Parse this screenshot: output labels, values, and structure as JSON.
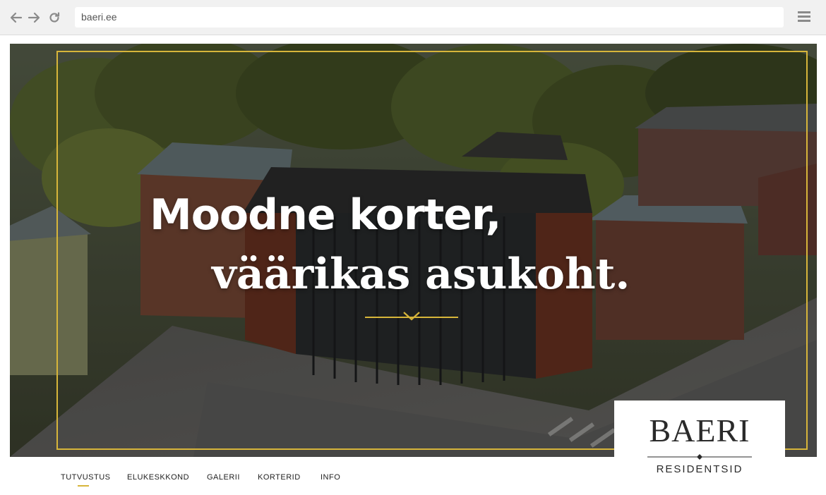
{
  "browser": {
    "url": "baeri.ee",
    "icons": {
      "back": "arrow-left-icon",
      "forward": "arrow-right-icon",
      "reload": "reload-icon",
      "menu": "hamburger-menu-icon"
    }
  },
  "hero": {
    "headline_line1": "Moodne korter,",
    "headline_line2": "väärikas asukoht.",
    "scroll_icon": "chevron-down-icon"
  },
  "logo": {
    "name": "BAERI",
    "subtitle": "RESIDENTSID"
  },
  "nav": {
    "items": [
      "TUTVUSTUS",
      "ELUKESKKOND",
      "GALERII",
      "KORTERID",
      "INFO"
    ],
    "active_index": 0
  },
  "colors": {
    "accent": "#d7b53a",
    "chrome": "#f1f1f1",
    "text_dark": "#2a2a2a"
  }
}
